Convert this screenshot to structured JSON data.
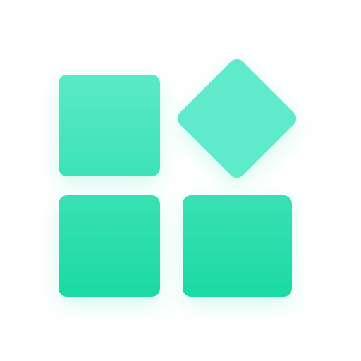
{
  "icon": {
    "name": "apps-grid-icon",
    "shapes": [
      "rounded-square",
      "diamond",
      "rounded-square",
      "rounded-square"
    ]
  },
  "colors": {
    "background": "#ffffff",
    "gradient_top": "#5FEBCB",
    "gradient_bottom": "#1BD9A2",
    "glow": "#3BE3B6"
  }
}
